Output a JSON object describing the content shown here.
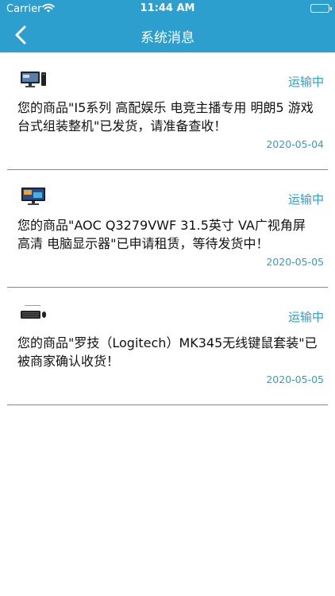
{
  "status_bar": {
    "carrier": "Carrier",
    "time": "11:44 AM"
  },
  "header": {
    "title": "系统消息"
  },
  "messages": [
    {
      "status": "运输中",
      "text": "您的商品\"I5系列 高配娱乐 电竞主播专用 明朗5 游戏台式组装整机\"已发货，请准备查收！",
      "date": "2020-05-04",
      "thumb_icon": "desktop-pc-icon"
    },
    {
      "status": "运输中",
      "text": "您的商品\"AOC Q3279VWF 31.5英寸 VA广视角屏 高清 电脑显示器\"已申请租赁，等待发货中！",
      "date": "2020-05-05",
      "thumb_icon": "monitor-icon"
    },
    {
      "status": "运输中",
      "text": "您的商品\"罗技（Logitech）MK345无线键鼠套装\"已被商家确认收货！",
      "date": "2020-05-05",
      "thumb_icon": "keyboard-mouse-icon"
    }
  ],
  "colors": {
    "brand": "#2d9fcf",
    "text": "#111111",
    "background": "#ffffff"
  }
}
